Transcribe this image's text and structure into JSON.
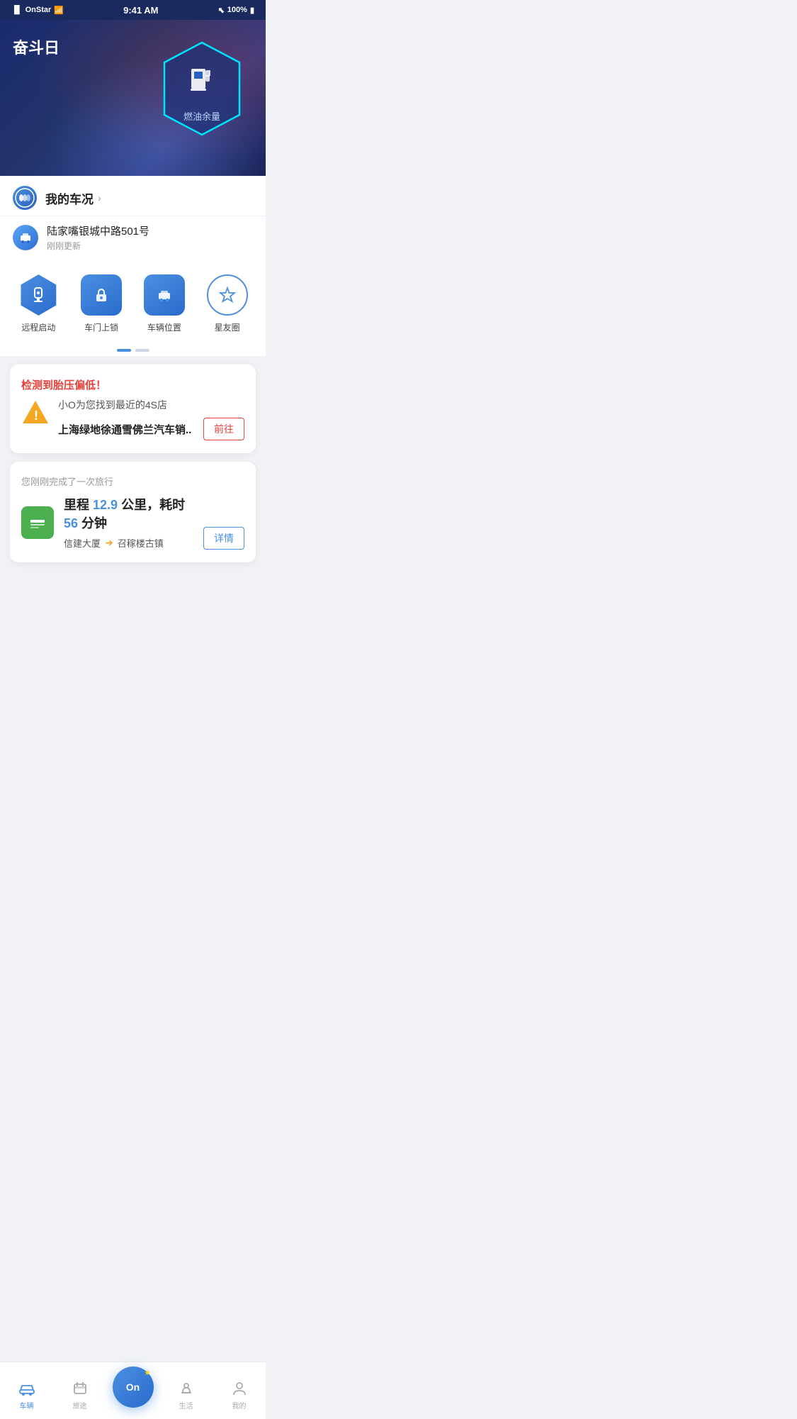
{
  "statusBar": {
    "carrier": "OnStar",
    "time": "9:41 AM",
    "battery": "100%",
    "wifi": true,
    "bluetooth": true
  },
  "hero": {
    "title": "奋斗日",
    "fuelLabel": "燃油余量"
  },
  "carStatus": {
    "label": "我的车况",
    "chevron": "›"
  },
  "location": {
    "address": "陆家嘴银城中路501号",
    "lastUpdated": "刚刚更新"
  },
  "quickActions": [
    {
      "id": "remote-start",
      "label": "远程启动",
      "icon": "▶"
    },
    {
      "id": "door-lock",
      "label": "车门上锁",
      "icon": "🔒"
    },
    {
      "id": "car-location",
      "label": "车辆位置",
      "icon": "🚗"
    },
    {
      "id": "star-circle",
      "label": "星友圈",
      "icon": "★"
    }
  ],
  "alert": {
    "title": "检测到胎压偏低！",
    "description": "小O为您找到最近的4S店",
    "shopName": "上海绿地徐通雪佛兰汽车销..",
    "gotoLabel": "前往"
  },
  "trip": {
    "header": "您刚刚完成了一次旅行",
    "distanceLabel": "里程",
    "distance": "12.9",
    "distanceUnit": "公里，耗时",
    "duration": "56",
    "durationUnit": "分钟",
    "from": "信建大厦",
    "to": "召稼楼古镇",
    "detailLabel": "详情"
  },
  "bottomNav": [
    {
      "id": "vehicle",
      "label": "车辆",
      "icon": "🔖",
      "active": true
    },
    {
      "id": "journey",
      "label": "旅途",
      "icon": "🧳",
      "active": false
    },
    {
      "id": "home",
      "label": "On",
      "icon": "On",
      "active": false,
      "center": true
    },
    {
      "id": "life",
      "label": "生活",
      "icon": "☕",
      "active": false
    },
    {
      "id": "mine",
      "label": "我的",
      "icon": "👤",
      "active": false
    }
  ]
}
